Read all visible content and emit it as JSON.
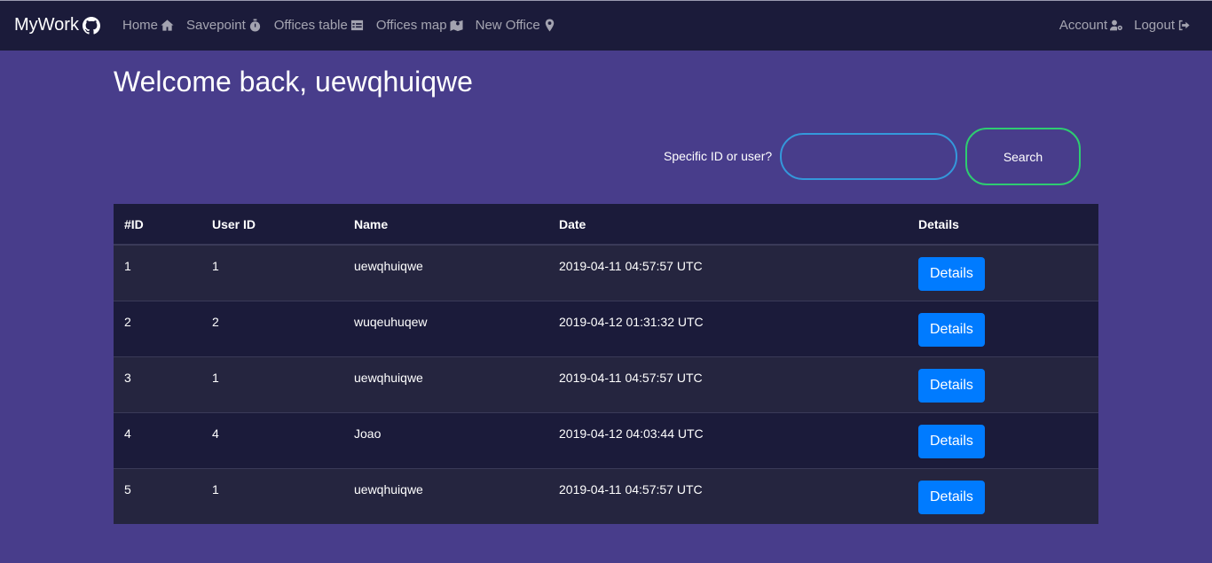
{
  "navbar": {
    "brand": "MyWork",
    "brand_icon": "github-icon",
    "links": [
      {
        "label": "Home",
        "icon": "home-icon"
      },
      {
        "label": "Savepoint",
        "icon": "stopwatch-icon"
      },
      {
        "label": "Offices table",
        "icon": "table-icon"
      },
      {
        "label": "Offices map",
        "icon": "map-icon"
      },
      {
        "label": "New Office",
        "icon": "map-marker-icon"
      }
    ],
    "right_links": [
      {
        "label": "Account",
        "icon": "user-cog-icon"
      },
      {
        "label": "Logout",
        "icon": "sign-out-icon"
      }
    ]
  },
  "welcome": "Welcome back, uewqhuiqwe",
  "search": {
    "label": "Specific ID or user?",
    "value": "",
    "button_label": "Search"
  },
  "table": {
    "headers": [
      "#ID",
      "User ID",
      "Name",
      "Date",
      "Details"
    ],
    "rows": [
      {
        "id": "1",
        "user_id": "1",
        "name": "uewqhuiqwe",
        "date": "2019-04-11 04:57:57 UTC",
        "details": "Details"
      },
      {
        "id": "2",
        "user_id": "2",
        "name": "wuqeuhuqew",
        "date": "2019-04-12 01:31:32 UTC",
        "details": "Details"
      },
      {
        "id": "3",
        "user_id": "1",
        "name": "uewqhuiqwe",
        "date": "2019-04-11 04:57:57 UTC",
        "details": "Details"
      },
      {
        "id": "4",
        "user_id": "4",
        "name": "Joao",
        "date": "2019-04-12 04:03:44 UTC",
        "details": "Details"
      },
      {
        "id": "5",
        "user_id": "1",
        "name": "uewqhuiqwe",
        "date": "2019-04-11 04:57:57 UTC",
        "details": "Details"
      }
    ]
  },
  "colors": {
    "background": "#483d8b",
    "navbar": "#1b1b3a",
    "input_border": "#3498db",
    "search_border": "#2ecc71",
    "details_button": "#007bff"
  }
}
